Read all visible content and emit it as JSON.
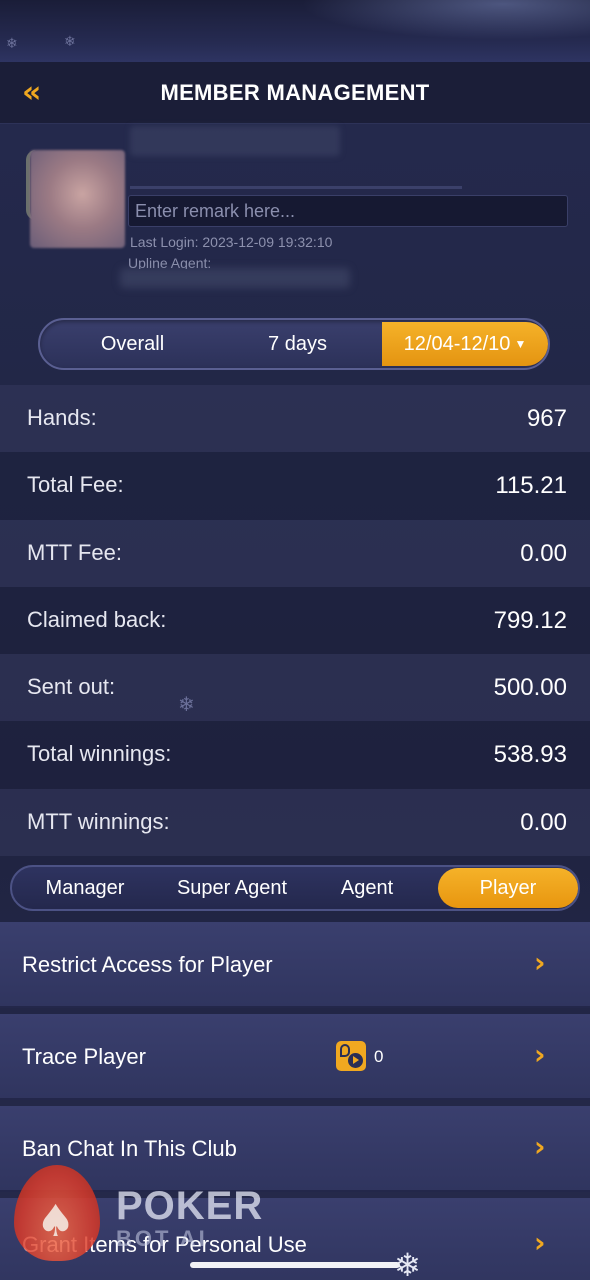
{
  "header": {
    "back_icon": "double-chevron-left-icon",
    "title": "MEMBER MANAGEMENT"
  },
  "profile": {
    "remark_placeholder": "Enter remark here...",
    "remark_value": "",
    "last_login": "Last Login: 2023-12-09 19:32:10",
    "upline_label": "Upline Agent:"
  },
  "period": {
    "options": [
      "Overall",
      "7 days",
      "12/04-12/10"
    ],
    "selected": "12/04-12/10",
    "caret_icon": "caret-down-icon"
  },
  "stats": [
    {
      "label": "Hands:",
      "value": "967"
    },
    {
      "label": "Total Fee:",
      "value": "115.21"
    },
    {
      "label": "MTT Fee:",
      "value": "0.00"
    },
    {
      "label": "Claimed back:",
      "value": "799.12"
    },
    {
      "label": "Sent out:",
      "value": "500.00"
    },
    {
      "label": "Total winnings:",
      "value": "538.93"
    },
    {
      "label": "MTT winnings:",
      "value": "0.00"
    }
  ],
  "roles": {
    "tabs": [
      "Manager",
      "Super Agent",
      "Agent",
      "Player"
    ],
    "selected": "Player"
  },
  "menu": [
    {
      "label": "Restrict Access for Player"
    },
    {
      "label": "Trace Player",
      "count": "0",
      "icon": "trace-player-icon"
    },
    {
      "label": "Ban Chat In This Club"
    },
    {
      "label": "Grant Items for Personal Use"
    }
  ],
  "watermark": {
    "brand": "POKER",
    "sub": "BOT AI"
  },
  "colors": {
    "accent": "#f0a820",
    "background": "#1f2340",
    "header": "#1b1e38",
    "menu_item": "#363b69"
  }
}
